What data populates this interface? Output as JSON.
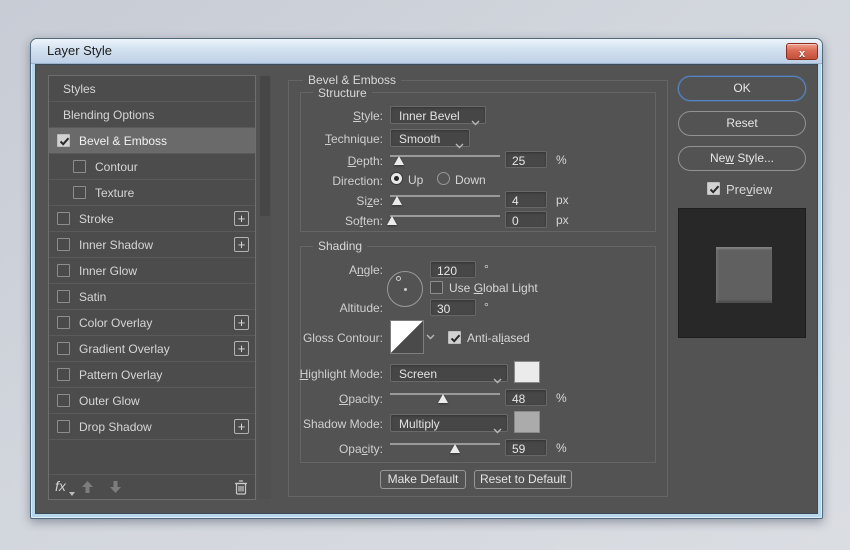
{
  "window": {
    "title": "Layer Style",
    "close_glyph": "x"
  },
  "sidebar": {
    "plus_glyph": "+",
    "fx_label": "fx",
    "items": [
      {
        "label": "Styles"
      },
      {
        "label": "Blending Options"
      },
      {
        "label": "Bevel & Emboss",
        "checked": true,
        "selected": true
      },
      {
        "label": "Contour",
        "checked": false,
        "indent": true
      },
      {
        "label": "Texture",
        "checked": false,
        "indent": true
      },
      {
        "label": "Stroke",
        "checked": false,
        "add": true
      },
      {
        "label": "Inner Shadow",
        "checked": false,
        "add": true
      },
      {
        "label": "Inner Glow",
        "checked": false
      },
      {
        "label": "Satin",
        "checked": false
      },
      {
        "label": "Color Overlay",
        "checked": false,
        "add": true
      },
      {
        "label": "Gradient Overlay",
        "checked": false,
        "add": true
      },
      {
        "label": "Pattern Overlay",
        "checked": false
      },
      {
        "label": "Outer Glow",
        "checked": false
      },
      {
        "label": "Drop Shadow",
        "checked": false,
        "add": true
      }
    ]
  },
  "main": {
    "section_title": "Bevel & Emboss",
    "structure": {
      "title": "Structure",
      "style": {
        "label": "Style:",
        "value": "Inner Bevel"
      },
      "technique": {
        "label": "Technique:",
        "value": "Smooth"
      },
      "depth": {
        "label": "Depth:",
        "value": "25",
        "unit": "%",
        "slider_pct": 8
      },
      "direction": {
        "label": "Direction:",
        "up": "Up",
        "down": "Down",
        "selected": "Up"
      },
      "size": {
        "label": "Size:",
        "value": "4",
        "unit": "px",
        "slider_pct": 6
      },
      "soften": {
        "label": "Soften:",
        "value": "0",
        "unit": "px",
        "slider_pct": 2
      }
    },
    "shading": {
      "title": "Shading",
      "angle": {
        "label": "Angle:",
        "value": "120",
        "unit": "°"
      },
      "use_global_light": {
        "label": "Use Global Light",
        "checked": false
      },
      "altitude": {
        "label": "Altitude:",
        "value": "30",
        "unit": "°"
      },
      "gloss_contour": {
        "label": "Gloss Contour:"
      },
      "anti_aliased": {
        "label": "Anti-aliased",
        "checked": true
      },
      "highlight_mode": {
        "label": "Highlight Mode:",
        "value": "Screen",
        "swatch": "#ebebeb"
      },
      "highlight_opacity": {
        "label": "Opacity:",
        "value": "48",
        "unit": "%",
        "slider_pct": 48
      },
      "shadow_mode": {
        "label": "Shadow Mode:",
        "value": "Multiply",
        "swatch": "#ababab"
      },
      "shadow_opacity": {
        "label": "Opacity:",
        "value": "59",
        "unit": "%",
        "slider_pct": 59
      }
    },
    "footer_buttons": {
      "make_default": "Make Default",
      "reset_to_default": "Reset to Default"
    }
  },
  "right": {
    "ok_label": "OK",
    "reset_label": "Reset",
    "new_style_label": "New Style...",
    "preview": {
      "label": "Preview",
      "checked": true
    }
  },
  "colors": {
    "accent_blue": "#5585c4",
    "close_red": "#d96a54",
    "dialog_bg": "#535353"
  }
}
